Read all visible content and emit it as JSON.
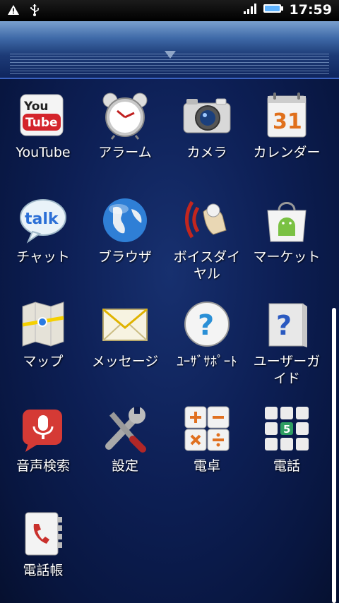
{
  "status_bar": {
    "left_icons": [
      "warning-icon",
      "usb-icon"
    ],
    "right_icons": [
      "signal-icon",
      "battery-icon"
    ],
    "time": "17:59"
  },
  "apps": [
    {
      "label": "YouTube",
      "icon": "youtube-icon"
    },
    {
      "label": "アラーム",
      "icon": "alarm-clock-icon"
    },
    {
      "label": "カメラ",
      "icon": "camera-icon"
    },
    {
      "label": "カレンダー",
      "icon": "calendar-icon",
      "icon_text": "31"
    },
    {
      "label": "チャット",
      "icon": "talk-icon",
      "icon_text": "talk"
    },
    {
      "label": "ブラウザ",
      "icon": "globe-icon"
    },
    {
      "label": "ボイスダイ\nヤル",
      "icon": "voice-dial-icon"
    },
    {
      "label": "マーケット",
      "icon": "market-icon"
    },
    {
      "label": "マップ",
      "icon": "map-icon"
    },
    {
      "label": "メッセージ",
      "icon": "envelope-icon"
    },
    {
      "label": "ﾕｰｻﾞｻﾎﾟｰﾄ",
      "icon": "help-icon"
    },
    {
      "label": "ユーザーガ\nイド",
      "icon": "user-guide-icon"
    },
    {
      "label": "音声検索",
      "icon": "microphone-icon"
    },
    {
      "label": "設定",
      "icon": "settings-tools-icon"
    },
    {
      "label": "電卓",
      "icon": "calculator-icon"
    },
    {
      "label": "電話",
      "icon": "dialpad-icon",
      "icon_text": "5"
    },
    {
      "label": "電話帳",
      "icon": "phonebook-icon"
    }
  ],
  "colors": {
    "background": "#0b1b4c",
    "header": "#2a4f8f",
    "accent": "#3b62c0"
  }
}
